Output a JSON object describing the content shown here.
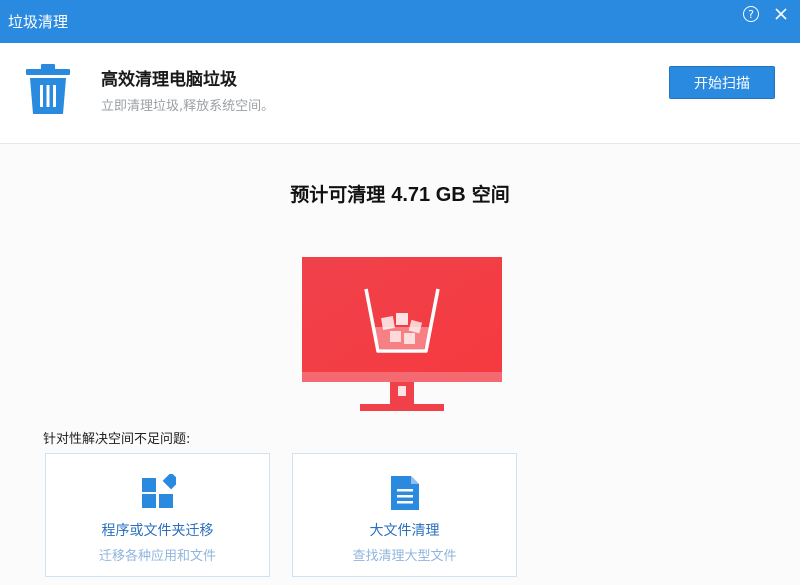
{
  "window": {
    "title": "垃圾清理",
    "help_icon": "help-icon",
    "close_icon": "close-icon"
  },
  "header": {
    "icon": "trash-icon",
    "title": "高效清理电脑垃圾",
    "subtitle": "立即清理垃圾,释放系统空间。",
    "scan_button": "开始扫描"
  },
  "estimate": {
    "prefix": "预计可清理",
    "size": "4.71 GB",
    "suffix": "空间"
  },
  "illustration": {
    "icon": "monitor-trash-illustration",
    "accent_color": "#f0414b"
  },
  "section": {
    "label": "针对性解决空间不足问题:"
  },
  "cards": [
    {
      "icon": "apps-grid-icon",
      "title": "程序或文件夹迁移",
      "subtitle": "迁移各种应用和文件"
    },
    {
      "icon": "document-icon",
      "title": "大文件清理",
      "subtitle": "查找清理大型文件"
    }
  ],
  "colors": {
    "brand_blue": "#2a8ae0",
    "link_blue": "#2a6fbf",
    "muted_blue": "#8fb5de",
    "alert_red": "#f0414b"
  }
}
